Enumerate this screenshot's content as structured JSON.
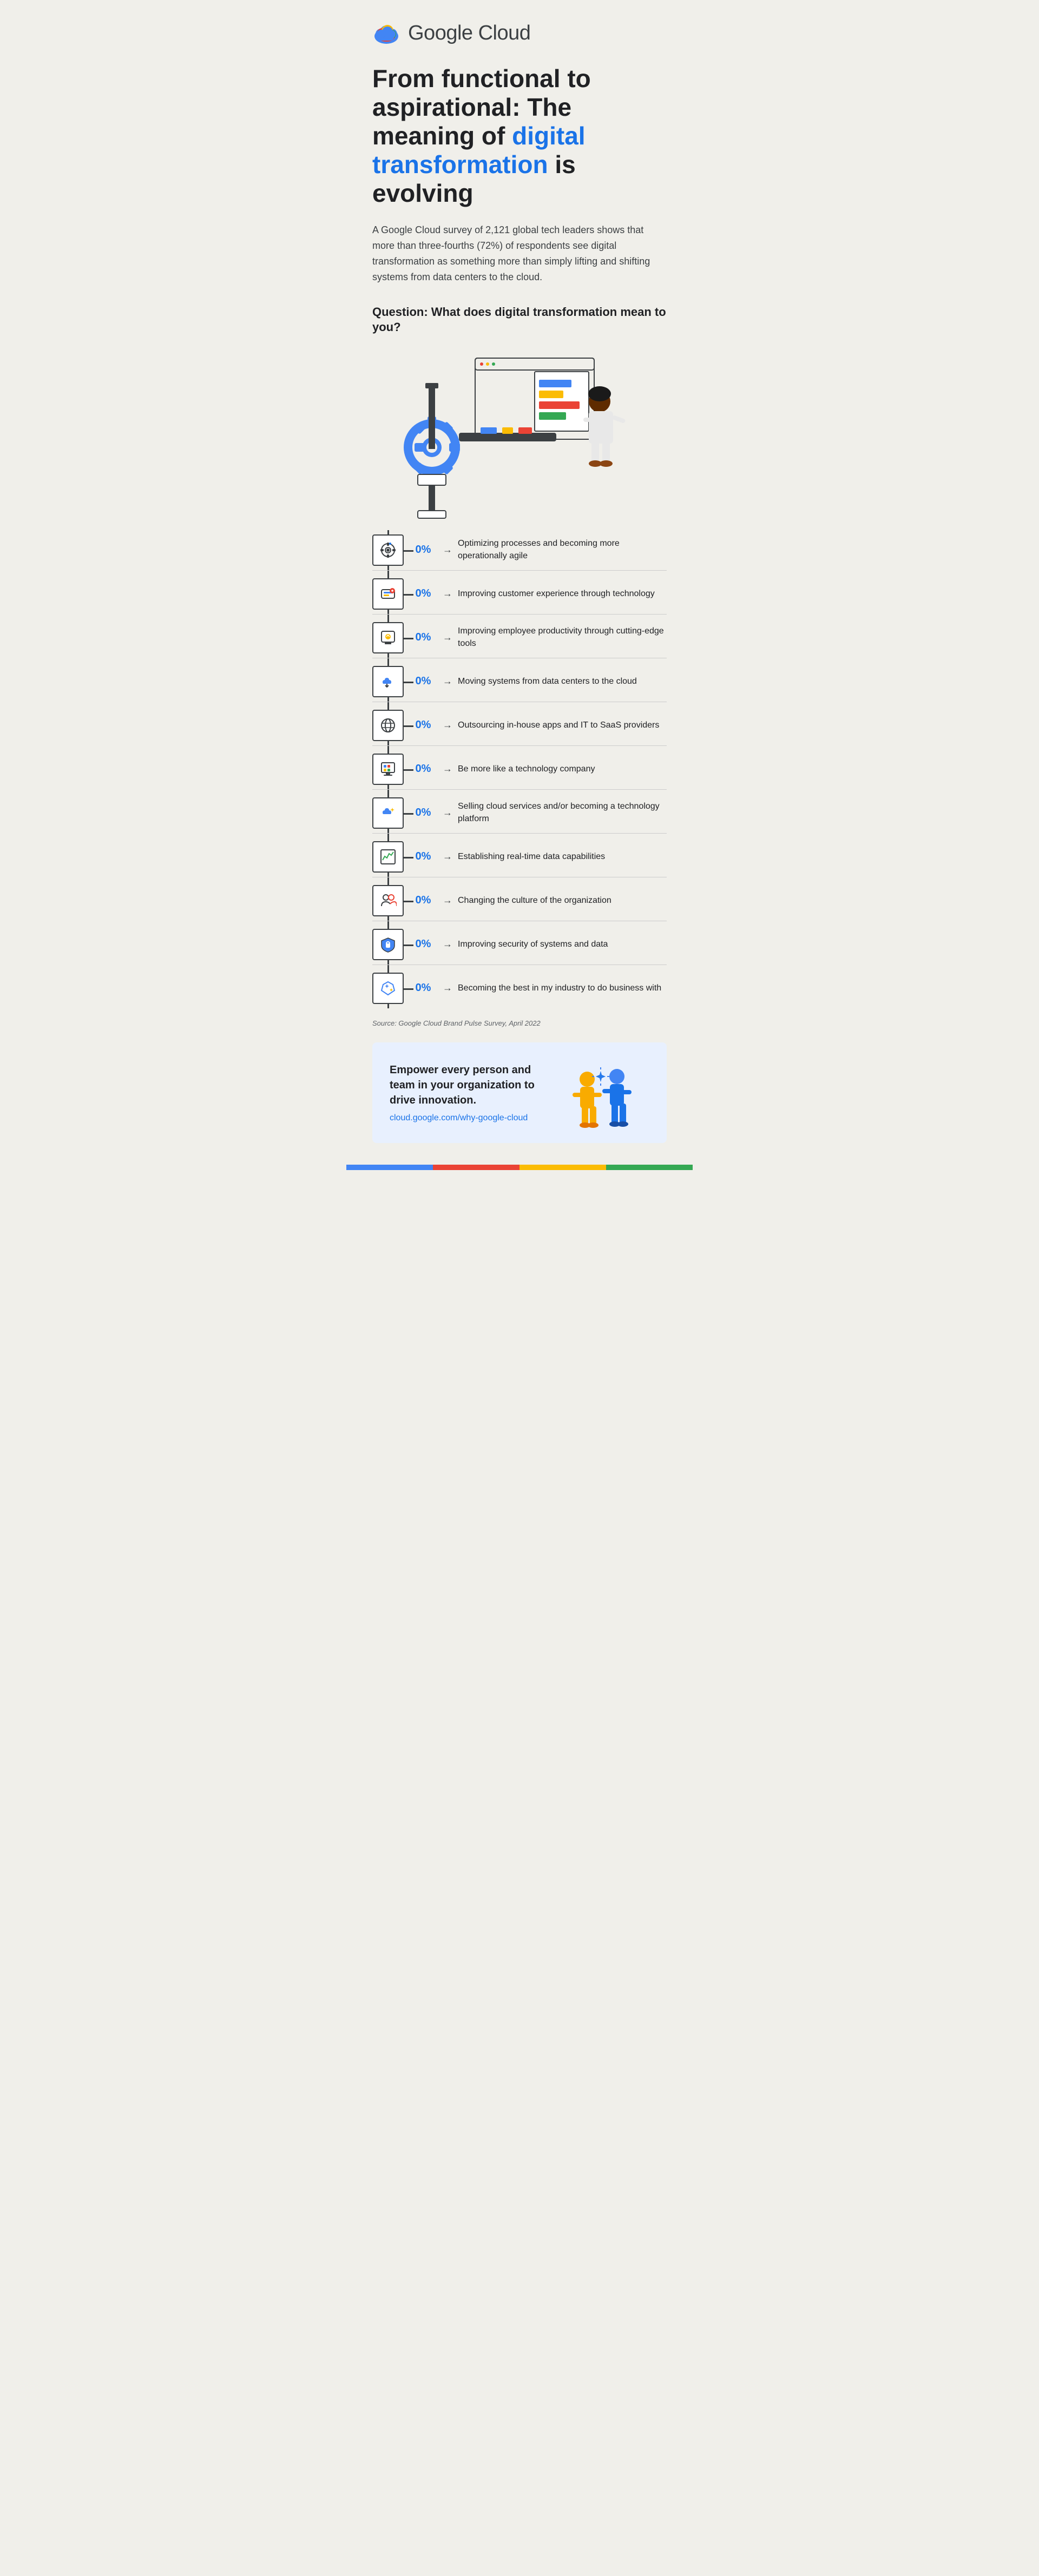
{
  "header": {
    "logo_alt": "Google Cloud logo",
    "brand_name": "Google Cloud"
  },
  "title": {
    "line1": "From functional to aspirational: The meaning",
    "highlight": "digital transformation",
    "line2": "is evolving",
    "full_plain": "From functional to aspirational: The meaning of ",
    "full_suffix": " is evolving"
  },
  "subtitle": "A Google Cloud survey of 2,121 global tech leaders shows that more than three-fourths (72%) of respondents see digital transformation as something more than simply lifting and shifting systems from data centers to the cloud.",
  "question_heading": "Question: What does digital transformation mean to you?",
  "chart_rows": [
    {
      "icon": "⚙",
      "pct": "0%",
      "label": "Optimizing processes and becoming more operationally agile"
    },
    {
      "icon": "🔧",
      "pct": "0%",
      "label": "Improving customer experience through technology"
    },
    {
      "icon": "💡",
      "pct": "0%",
      "label": "Improving employee productivity through cutting-edge tools"
    },
    {
      "icon": "☁",
      "pct": "0%",
      "label": "Moving systems from data centers to the cloud"
    },
    {
      "icon": "🌐",
      "pct": "0%",
      "label": "Outsourcing in-house apps and IT to SaaS providers"
    },
    {
      "icon": "🖥",
      "pct": "0%",
      "label": "Be more like a technology company"
    },
    {
      "icon": "✨",
      "pct": "0%",
      "label": "Selling cloud services and/or becoming a technology platform"
    },
    {
      "icon": "📈",
      "pct": "0%",
      "label": "Establishing real-time data capabilities"
    },
    {
      "icon": "👥",
      "pct": "0%",
      "label": "Changing the culture of the organization"
    },
    {
      "icon": "🔒",
      "pct": "0%",
      "label": "Improving security of systems and data"
    },
    {
      "icon": "🏆",
      "pct": "0%",
      "label": "Becoming the best in my industry to do business with"
    }
  ],
  "source": "Source: Google Cloud Brand Pulse Survey, April 2022",
  "footer": {
    "title": "Empower every person and team in your organization to drive innovation.",
    "link": "cloud.google.com/why-google-cloud"
  }
}
